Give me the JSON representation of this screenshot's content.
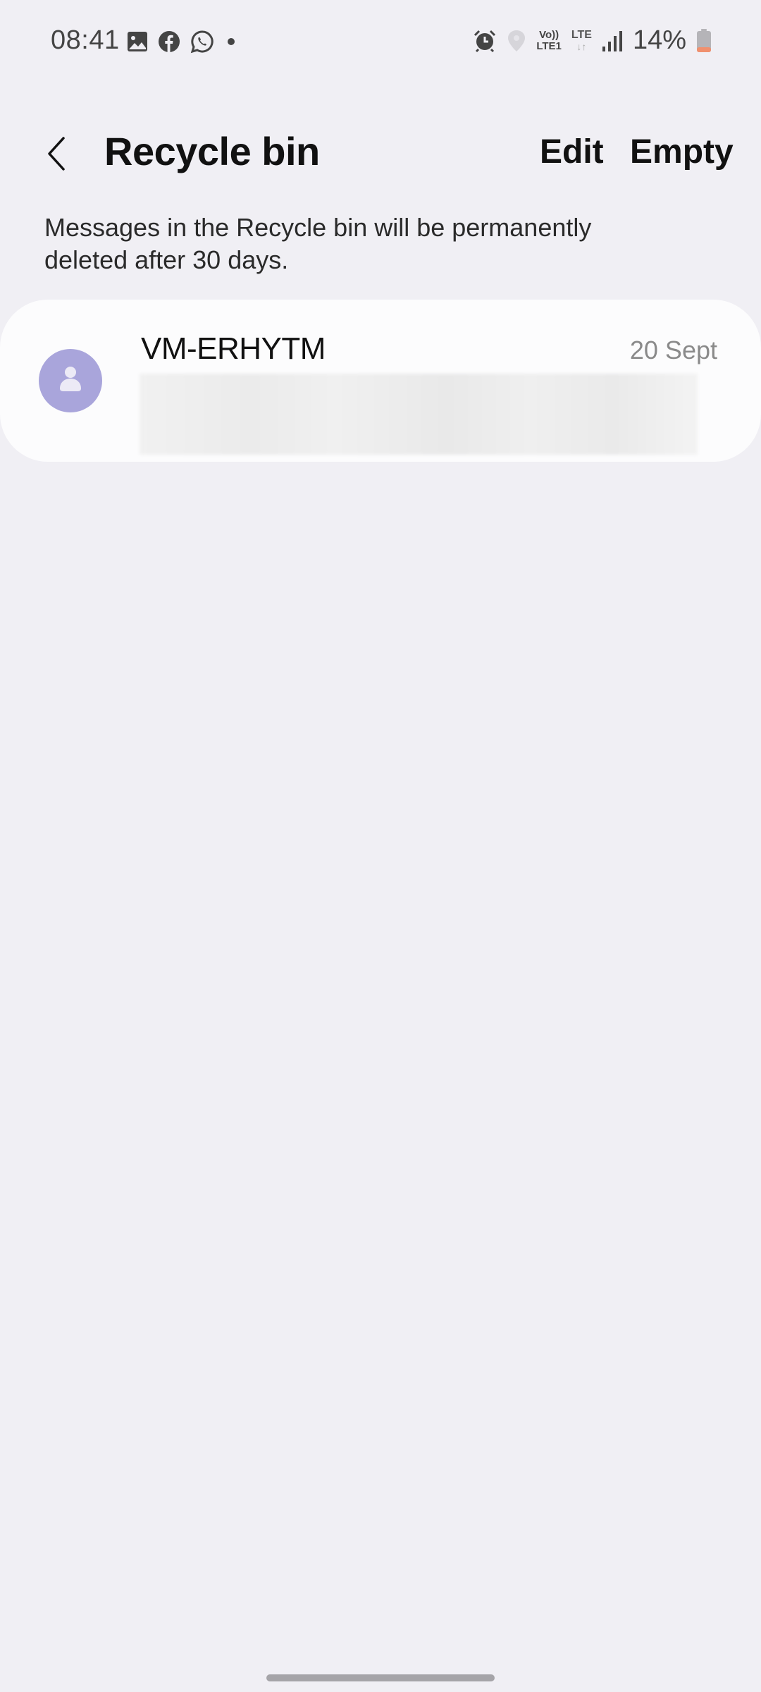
{
  "status_bar": {
    "time": "08:41",
    "left_icons": [
      "gallery-notification-icon",
      "facebook-icon",
      "whatsapp-icon",
      "more-notifications-dot"
    ],
    "right_icons": [
      "alarm-icon",
      "location-icon",
      "volte-icon",
      "lte-data-icon",
      "signal-icon",
      "battery-icon"
    ],
    "volte_top": "Vo))",
    "volte_bottom": "LTE1",
    "lte_label": "LTE",
    "lte_arrows": "↓↑",
    "battery_percent": "14%",
    "battery_level": 0.14,
    "battery_low_color": "#f0906e"
  },
  "app_bar": {
    "title": "Recycle bin",
    "actions": {
      "edit": "Edit",
      "empty": "Empty"
    }
  },
  "info": {
    "text": "Messages in the Recycle bin will be permanently deleted after 30 days."
  },
  "conversations": [
    {
      "sender": "VM-ERHYTM",
      "date": "20 Sept",
      "preview": "",
      "preview_redacted": true,
      "avatar_color": "#a9a5db"
    }
  ]
}
